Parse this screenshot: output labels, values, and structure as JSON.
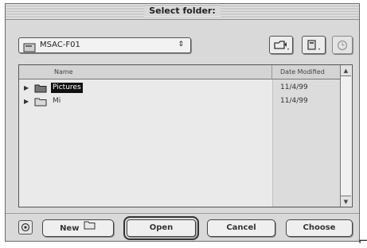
{
  "dialog": {
    "title": "Select folder:"
  },
  "location_popup": {
    "selected": "MSAC-F01",
    "arrows": "⇕"
  },
  "toolbar": {
    "icons": [
      "shortcuts-icon",
      "favorites-icon",
      "recent-icon"
    ]
  },
  "file_list": {
    "columns": {
      "name": "Name",
      "date": "Date Modified"
    },
    "rows": [
      {
        "name": "Pictures",
        "date": "11/4/99",
        "selected": true
      },
      {
        "name": "Mi",
        "date": "11/4/99",
        "selected": false
      }
    ]
  },
  "buttons": {
    "new": "New",
    "open": "Open",
    "cancel": "Cancel",
    "choose": "Choose"
  },
  "colors": {
    "dialog_bg": "#d9d9d9",
    "selection": "#111111",
    "date_column_bg": "#dcdcdc"
  }
}
